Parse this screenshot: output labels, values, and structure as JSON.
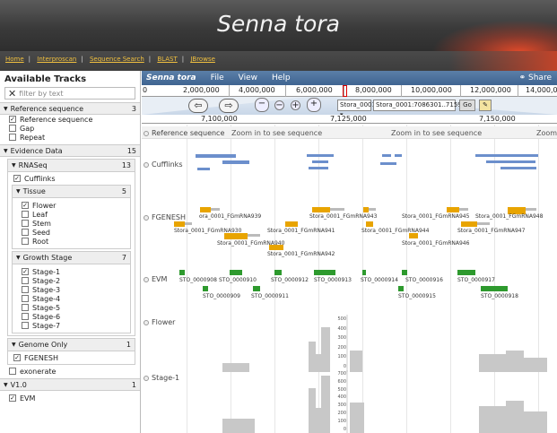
{
  "banner": {
    "title": "Senna tora"
  },
  "nav": {
    "links": [
      "Home",
      "Interproscan",
      "Sequence Search",
      "BLAST",
      "JBrowse"
    ]
  },
  "sidebar": {
    "title": "Available Tracks",
    "filter_placeholder": "filter by text",
    "categories": [
      {
        "label": "Reference sequence",
        "count": "3",
        "items": [
          {
            "label": "Reference sequence",
            "checked": true
          },
          {
            "label": "Gap",
            "checked": false
          },
          {
            "label": "Repeat",
            "checked": false
          }
        ]
      },
      {
        "label": "Evidence Data",
        "count": "15"
      }
    ],
    "rnaseq": {
      "label": "RNASeq",
      "count": "13",
      "cufflinks": "Cufflinks"
    },
    "tissue": {
      "label": "Tissue",
      "count": "5",
      "items": [
        "Flower",
        "Leaf",
        "Stem",
        "Seed",
        "Root"
      ]
    },
    "growth": {
      "label": "Growth Stage",
      "count": "7",
      "items": [
        "Stage-1",
        "Stage-2",
        "Stage-3",
        "Stage-4",
        "Stage-5",
        "Stage-6",
        "Stage-7"
      ]
    },
    "genome_only": {
      "label": "Genome Only",
      "count": "1",
      "item": "FGENESH"
    },
    "exonerate": "exonerate",
    "v1": {
      "label": "V1.0",
      "count": "1",
      "item": "EVM"
    }
  },
  "menubar": {
    "brand": "Senna tora",
    "file": "File",
    "view": "View",
    "help": "Help",
    "share": "Share"
  },
  "overview_ticks": [
    "0",
    "2,000,000",
    "4,000,000",
    "6,000,000",
    "8,000,000",
    "10,000,000",
    "12,000,000",
    "14,000,0"
  ],
  "location": {
    "ref": "Stora_0001",
    "range": "Stora_0001:7086301..7159200",
    "go": "Go"
  },
  "scale_ticks": [
    "7,100,000",
    "7,125,000",
    "7,150,000"
  ],
  "tracks": {
    "reference": "Reference sequence",
    "zoom_msg": "Zoom in to see sequence",
    "zoom_short": "Zoom",
    "cufflinks": "Cufflinks",
    "fgenesh": "FGENESH",
    "evm": "EVM",
    "flower": "Flower",
    "stage1": "Stage-1"
  },
  "fgenesh_labels": [
    "ora_0001_FGmRNA939",
    "Stora_0001_FGmRNA943",
    "Stora_0001_FGmRNA945",
    "Stora_0001_FGmRNA948",
    "Stora_0001_FGmRNA930",
    "Stora_0001_FGmRNA941",
    "Stora_0001_FGmRNA944",
    "Stora_0001_FGmRNA947",
    "Stora_0001_FGmRNA940",
    "Stora_0001_FGmRNA946",
    "Stora_0001_FGmRNA942"
  ],
  "evm_labels": [
    "STO_0000908",
    "STO_0000910",
    "STO_0000912",
    "STO_0000913",
    "STO_0000914",
    "STO_0000916",
    "STO_0000917",
    "STO_0000909",
    "STO_0000911",
    "STO_0000915",
    "STO_0000918"
  ],
  "flower_axis": [
    "500",
    "400",
    "300",
    "200",
    "100",
    "0"
  ],
  "stage1_axis": [
    "700",
    "600",
    "500",
    "400",
    "300",
    "200",
    "100",
    "0"
  ]
}
